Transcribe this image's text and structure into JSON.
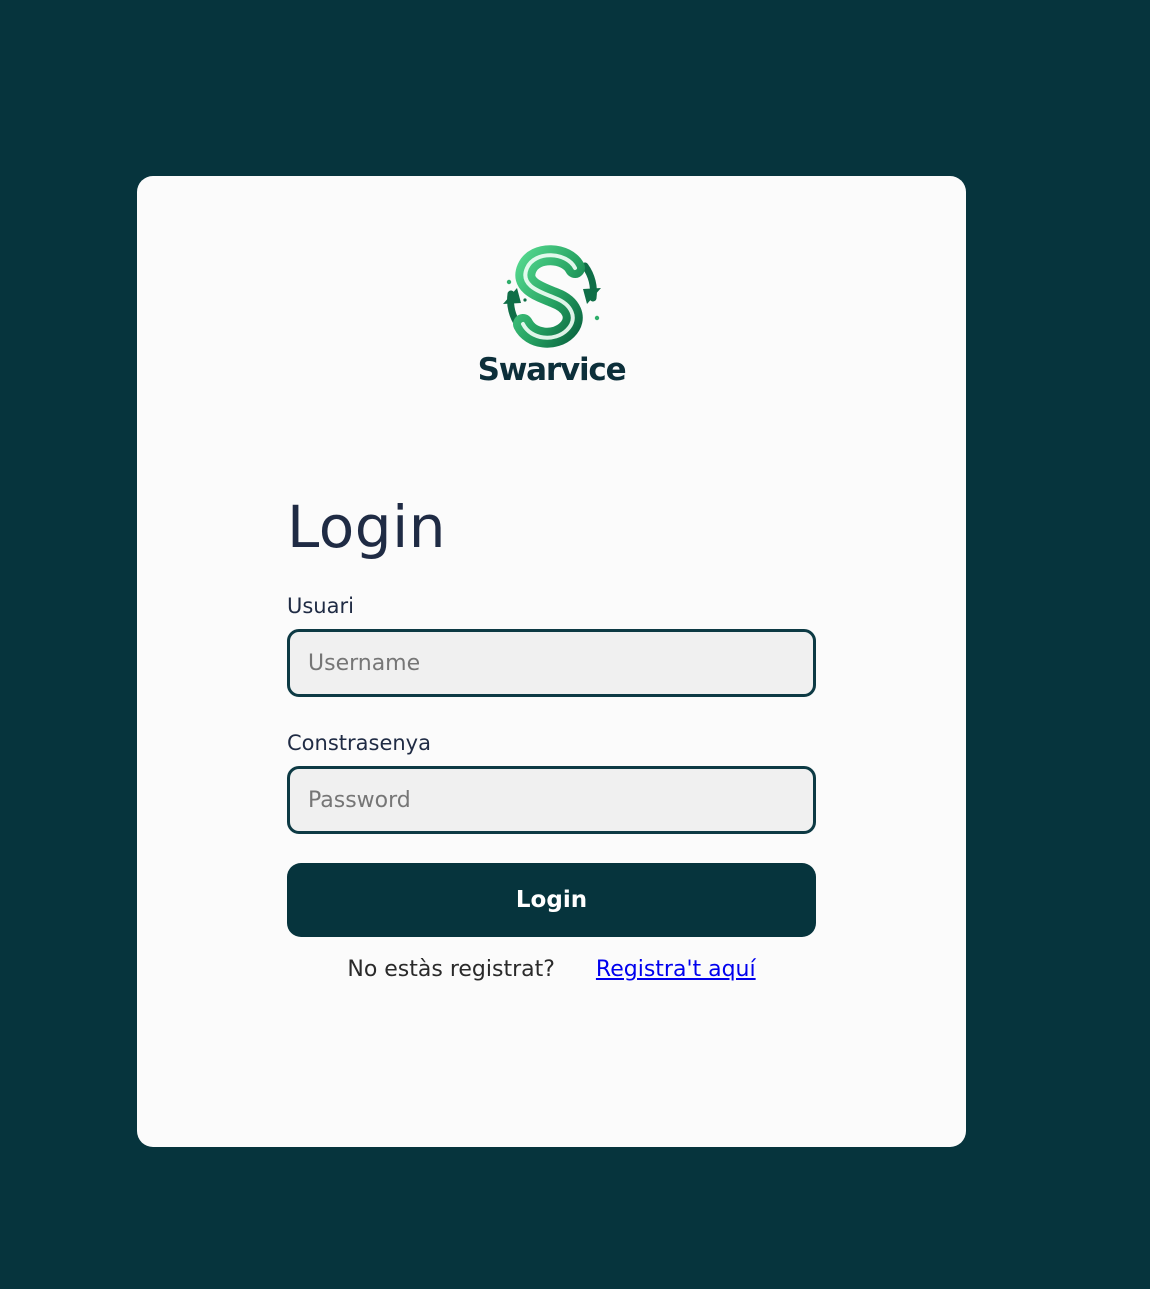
{
  "brand": {
    "name": "Swarvice",
    "logo_icon": "swarvice-s-arrows-logo",
    "colors": {
      "background": "#06343d",
      "card": "#fbfbfb",
      "logo_green": "#2fae6b",
      "logo_dark_green": "#0e6b45",
      "link": "#0000ee"
    }
  },
  "login": {
    "title": "Login",
    "username_label": "Usuari",
    "username_placeholder": "Username",
    "password_label": "Constrasenya",
    "password_placeholder": "Password",
    "submit_label": "Login",
    "register_prompt": "No estàs registrat?",
    "register_link": "Registra't aquí"
  }
}
